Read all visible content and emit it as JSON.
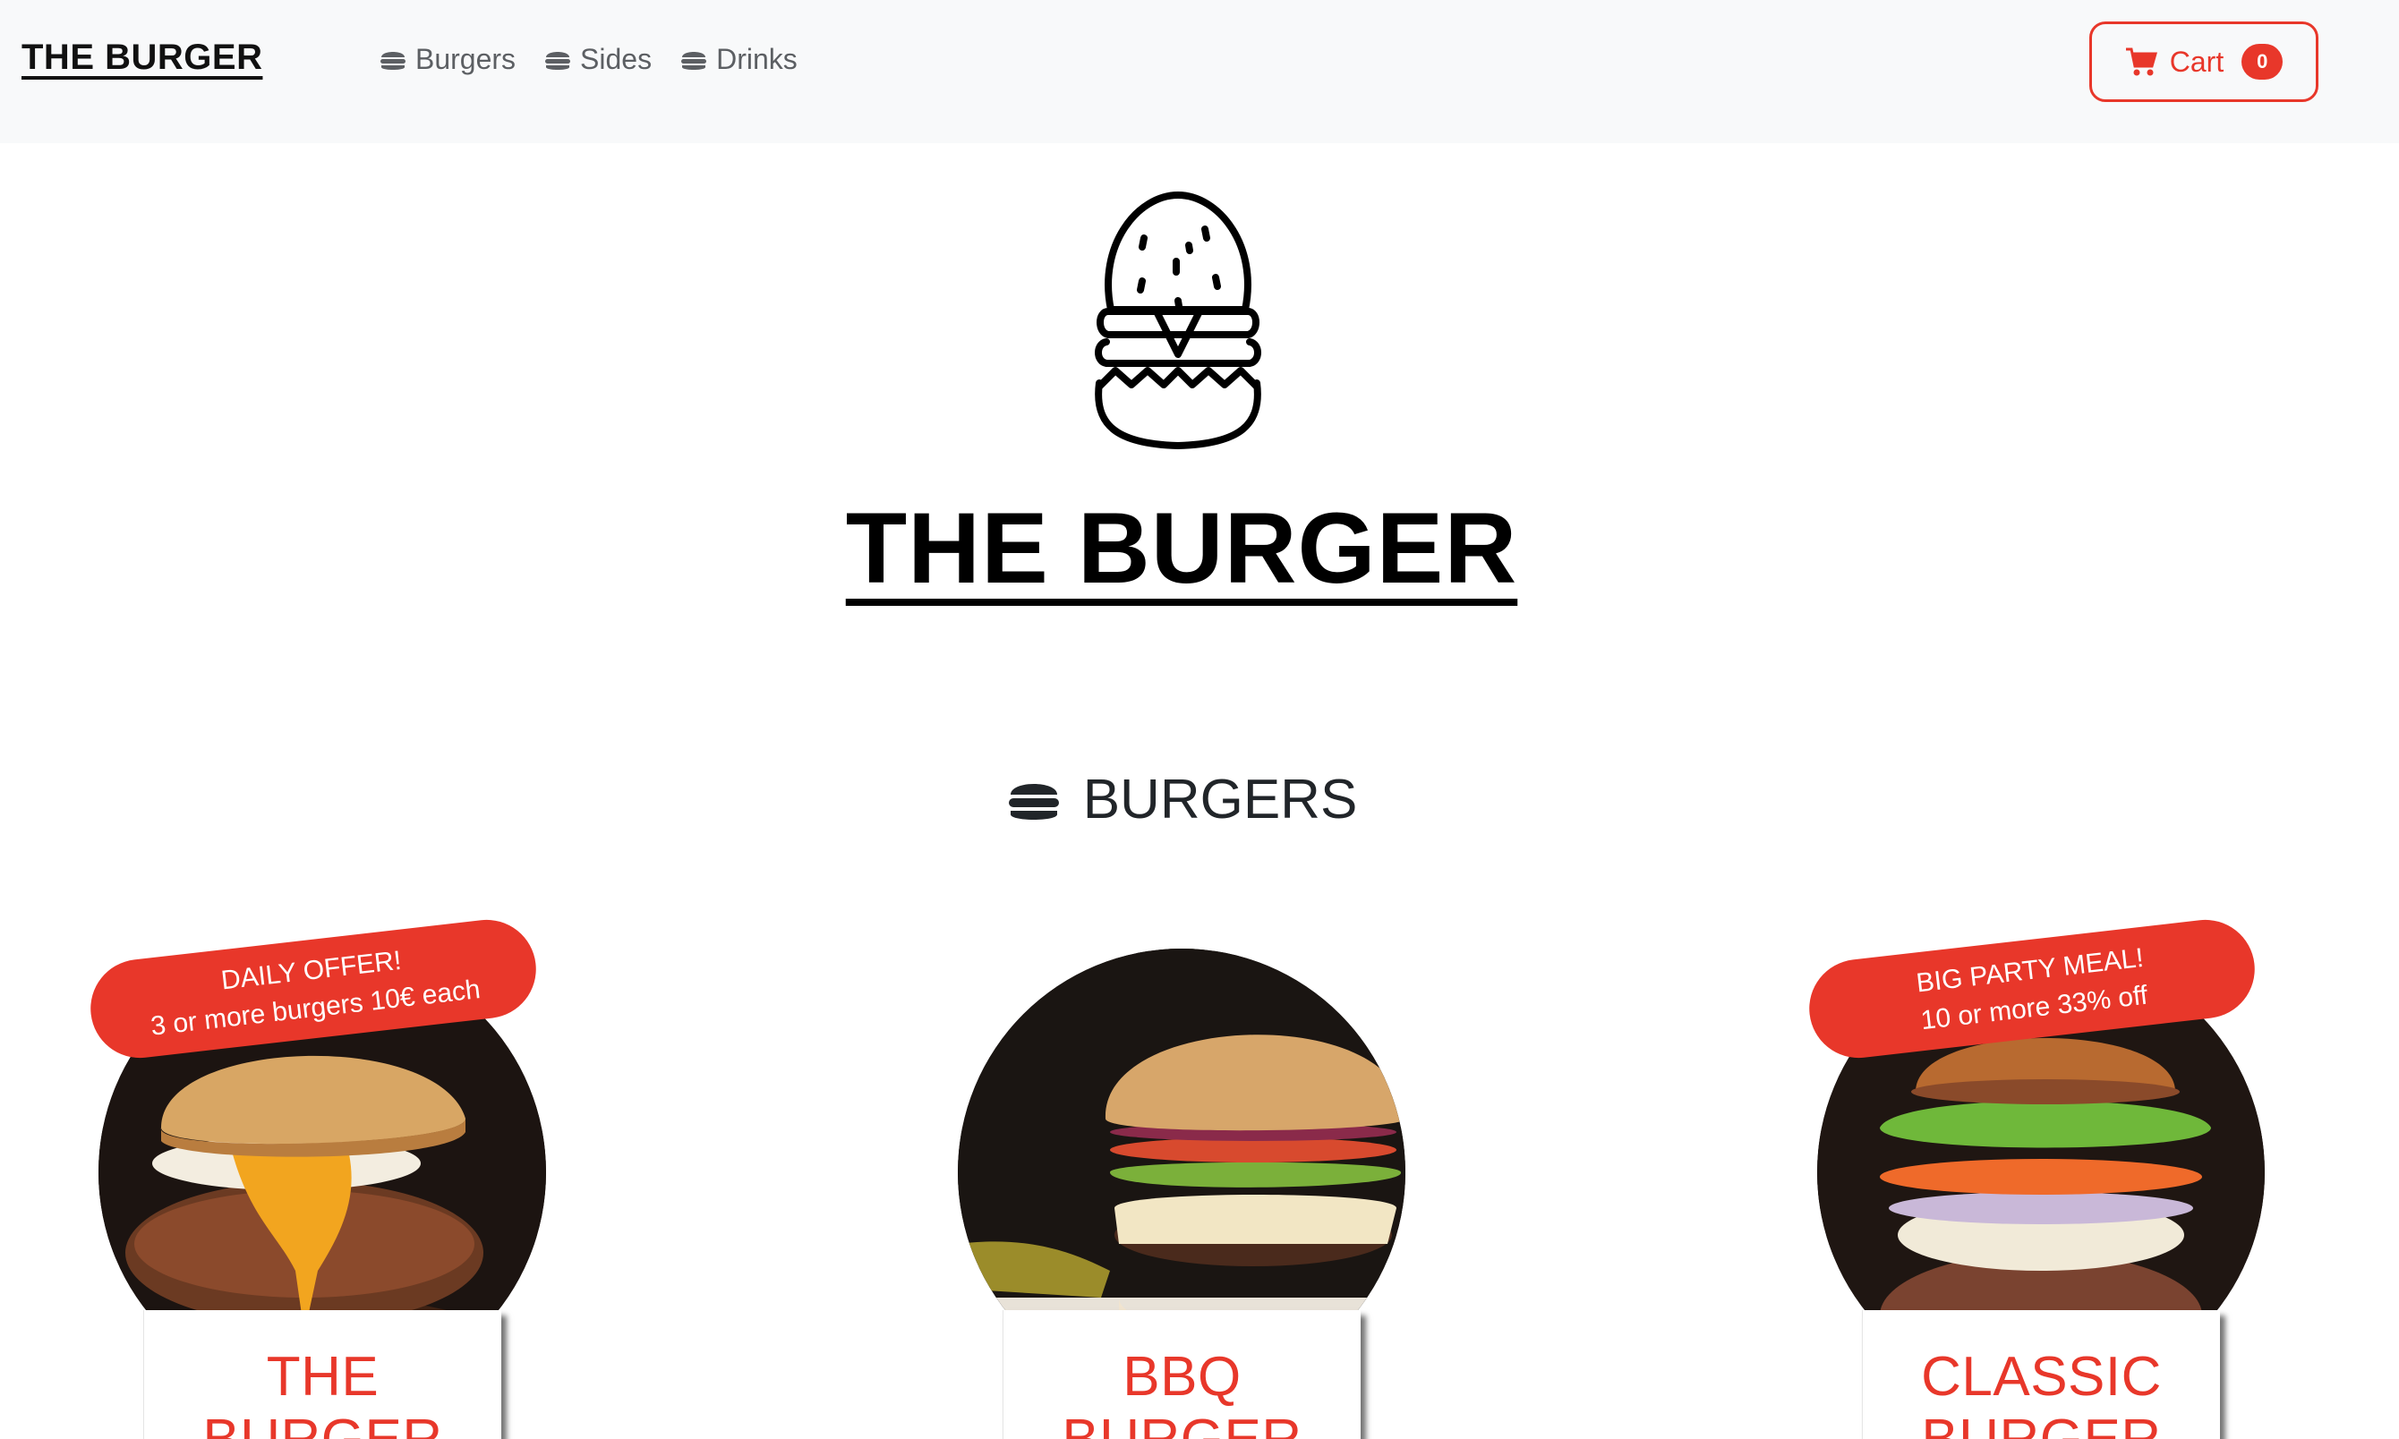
{
  "navbar": {
    "brand": "THE BURGER",
    "links": [
      {
        "label": "Burgers",
        "icon": "burger-icon"
      },
      {
        "label": "Sides",
        "icon": "burger-icon"
      },
      {
        "label": "Drinks",
        "icon": "burger-icon"
      }
    ],
    "cart": {
      "label": "Cart",
      "count": "0",
      "icon": "cart-icon"
    }
  },
  "hero": {
    "title": "THE BURGER",
    "logo_icon": "burger-logo-icon"
  },
  "section": {
    "title": "BURGERS",
    "icon": "burger-icon"
  },
  "products": [
    {
      "name_line1": "THE",
      "name_line2": "BURGER",
      "ribbon_line1": "DAILY OFFER!",
      "ribbon_line2": "3 or more burgers 10€ each"
    },
    {
      "name_line1": "BBQ",
      "name_line2": "BURGER"
    },
    {
      "name_line1": "CLASSIC",
      "name_line2": "BURGER",
      "ribbon_line1": "BIG PARTY MEAL!",
      "ribbon_line2": "10 or more 33% off"
    }
  ],
  "colors": {
    "accent": "#e8372a",
    "navbar_bg": "#f8f9fa",
    "nav_text": "#5c5f63"
  }
}
